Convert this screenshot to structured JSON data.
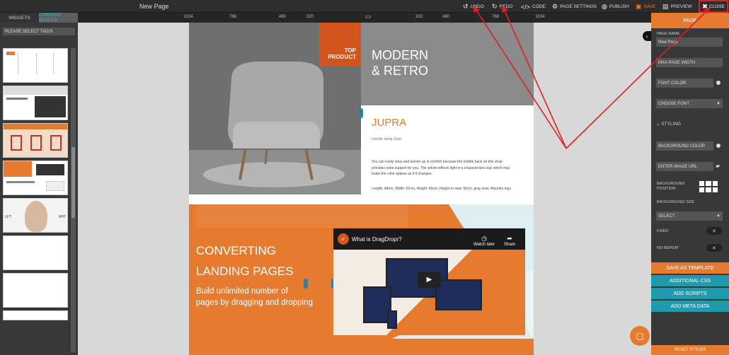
{
  "topbar": {
    "page_title": "New Page",
    "undo": "UNDO",
    "redo": "REDO",
    "code": "CODE",
    "page_settings": "PAGE SETTINGS",
    "publish": "PUBLISH",
    "save": "SAVE",
    "preview": "PREVIEW",
    "close": "CLOSE"
  },
  "ruler": {
    "ticks": [
      "1024",
      "768",
      "480",
      "320",
      "320",
      "480",
      "768",
      "1024"
    ]
  },
  "left_panel": {
    "tabs": [
      "WIDGETS",
      "CONTENT BLOCKS"
    ],
    "tag_select": "PLEASE SELECT TAG/S",
    "thumb_labels": [
      "LFT",
      "RHT"
    ]
  },
  "canvas": {
    "tag": {
      "line1": "TOP",
      "line2": "PRODUCT"
    },
    "hero_title": "MODERN\n& RETRO",
    "product_title": "JUPRA",
    "product_sub": "middle wing chair",
    "product_desc": "You can really relax and loosen up in comfort because the middle back on this chair provides extra support for you. The velvet reflects light in a characteristic way which may make the color appear as if it changes.",
    "product_dims": "Length: 84cm, Width: 52cm, Height: 80cm, Height to seat: 55cm, gray seat, Wooden legs",
    "conv_line1": "CONVERTING",
    "conv_line2": "LANDING PAGES",
    "conv_sub1": "Build unlimited number of",
    "conv_sub2": "pages by dragging and dropping",
    "video_title": "What is DragDropr?",
    "watch_later": "Watch later",
    "share": "Share"
  },
  "right_panel": {
    "header": "PAGE",
    "page_name_label": "PAGE NAME",
    "page_name_value": "New Page",
    "max_width": "MAX PAGE WIDTH",
    "font_color": "FONT COLOR",
    "choose_font": "CHOOSE FONT",
    "styling": "STYLING",
    "bg_color": "BACKGROUND COLOR",
    "image_url": "ENTER IMAGE URL",
    "bg_position": "BACKGROUND POSITION",
    "bg_size": "BACKGROUND SIZE",
    "select": "SELECT",
    "fixed": "FIXED",
    "no_repeat": "NO REPEAT",
    "save_template": "SAVE AS TEMPLATE",
    "additional_css": "ADDITIONAL CSS",
    "add_scripts": "ADD SCRIPTS",
    "add_meta": "ADD META DATA",
    "reset_styles": "RESET STYLES"
  },
  "colors": {
    "accent": "#e67a2f",
    "teal": "#1f9bb0",
    "annotation": "#e02020"
  }
}
